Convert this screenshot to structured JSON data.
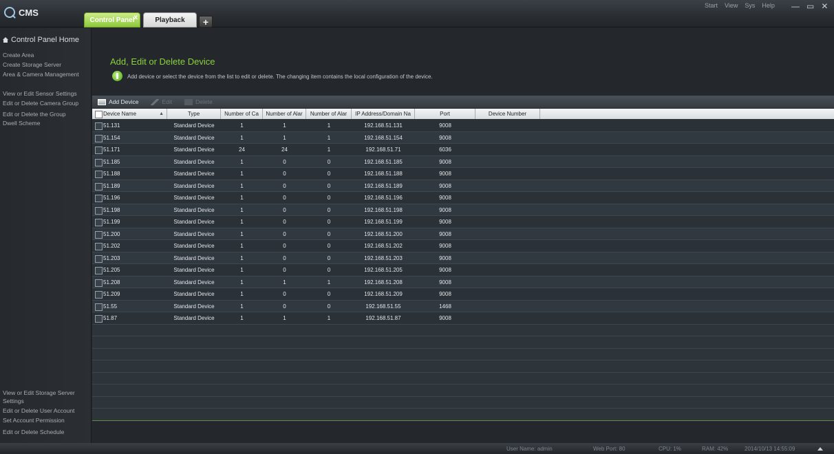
{
  "app": {
    "title": "CMS"
  },
  "menu": [
    "Start",
    "View",
    "Sys",
    "Help"
  ],
  "window_controls": [
    "—",
    "▭",
    "✕"
  ],
  "tabs": [
    {
      "label": "Control Panel",
      "close": "x"
    },
    {
      "label": "Playback"
    },
    {
      "label": "+"
    }
  ],
  "sidebar": {
    "home": "Control Panel Home",
    "top_items": [
      "Create Area",
      "Create Storage Server",
      "Area & Camera Management",
      "View or Edit Sensor Settings",
      "Edit or Delete Camera Group",
      "Edit or Delete the Group",
      "Dwell Scheme"
    ],
    "bottom_items": [
      "View or Edit Storage Server",
      "Settings",
      "Edit or Delete User Account",
      "Set Account Permission",
      "Edit or Delete Schedule"
    ]
  },
  "main": {
    "title": "Add, Edit or Delete Device",
    "hint": "Add device or select the device from the list to edit or delete. The changing item contains the local configuration of the device.",
    "toolbar": {
      "add": "Add Device",
      "edit": "Edit",
      "delete": "Delete"
    }
  },
  "table": {
    "columns": [
      "Device Name",
      "Type",
      "Number of Ca",
      "Number of Alar",
      "Number of Alar",
      "IP Address/Domain Na",
      "Port",
      "Device Number"
    ],
    "sort_indicator": "▲",
    "rows": [
      [
        "51.131",
        "Standard Device",
        "1",
        "1",
        "1",
        "192.168.51.131",
        "9008"
      ],
      [
        "51.154",
        "Standard Device",
        "1",
        "1",
        "1",
        "192.168.51.154",
        "9008"
      ],
      [
        "51.171",
        "Standard Device",
        "24",
        "24",
        "1",
        "192.168.51.71",
        "6036"
      ],
      [
        "51.185",
        "Standard Device",
        "1",
        "0",
        "0",
        "192.168.51.185",
        "9008"
      ],
      [
        "51.188",
        "Standard Device",
        "1",
        "0",
        "0",
        "192.168.51.188",
        "9008"
      ],
      [
        "51.189",
        "Standard Device",
        "1",
        "0",
        "0",
        "192.168.51.189",
        "9008"
      ],
      [
        "51.196",
        "Standard Device",
        "1",
        "0",
        "0",
        "192.168.51.196",
        "9008"
      ],
      [
        "51.198",
        "Standard Device",
        "1",
        "0",
        "0",
        "192.168.51.198",
        "9008"
      ],
      [
        "51.199",
        "Standard Device",
        "1",
        "0",
        "0",
        "192.168.51.199",
        "9008"
      ],
      [
        "51.200",
        "Standard Device",
        "1",
        "0",
        "0",
        "192.168.51.200",
        "9008"
      ],
      [
        "51.202",
        "Standard Device",
        "1",
        "0",
        "0",
        "192.168.51.202",
        "9008"
      ],
      [
        "51.203",
        "Standard Device",
        "1",
        "0",
        "0",
        "192.168.51.203",
        "9008"
      ],
      [
        "51.205",
        "Standard Device",
        "1",
        "0",
        "0",
        "192.168.51.205",
        "9008"
      ],
      [
        "51.208",
        "Standard Device",
        "1",
        "1",
        "1",
        "192.168.51.208",
        "9008"
      ],
      [
        "51.209",
        "Standard Device",
        "1",
        "0",
        "0",
        "192.168.51.209",
        "9008"
      ],
      [
        "51.55",
        "Standard Device",
        "1",
        "0",
        "0",
        "192.168.51.55",
        "1468"
      ],
      [
        "51.87",
        "Standard Device",
        "1",
        "1",
        "1",
        "192.168.51.87",
        "9008"
      ]
    ]
  },
  "statusbar": {
    "user": "User Name: admin",
    "web_port": "Web Port: 80",
    "cpu": "CPU: 1%",
    "ram": "RAM: 42%",
    "datetime": "2014/10/13 14:55:09"
  },
  "colors": {
    "accent": "#8ad23a",
    "tab_active": "#8cc93a",
    "background": "#24282c"
  }
}
